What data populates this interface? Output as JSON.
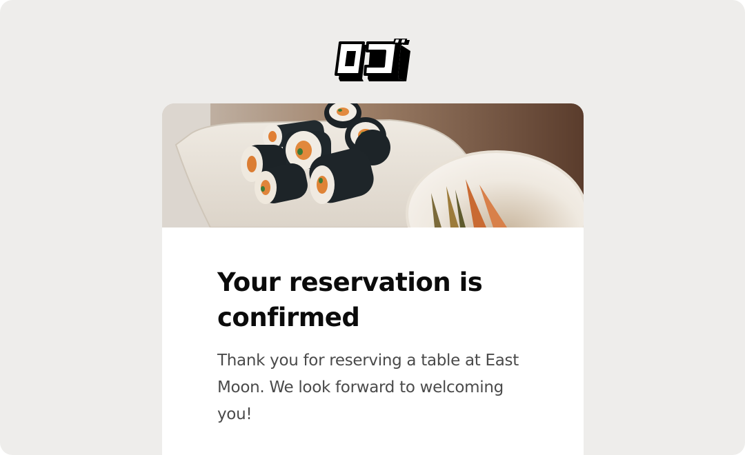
{
  "brand": {
    "logo_text": "OJ",
    "logo_icon": "restaurant-logo-icon"
  },
  "email": {
    "hero_image": "sushi-rolls-photo",
    "headline": "Your reservation is confirmed",
    "body": "Thank you for reserving a table at East Moon. We look forward to welcoming you!"
  },
  "colors": {
    "page_background": "#eeedeb",
    "card_background": "#ffffff",
    "headline": "#0b0b0b",
    "body_text": "#4a4a4a"
  }
}
